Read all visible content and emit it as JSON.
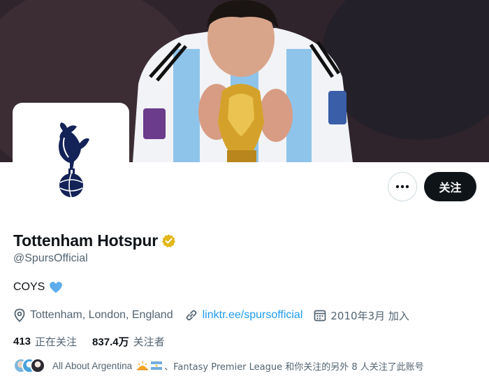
{
  "banner": {
    "description_icon": "world-cup-banner"
  },
  "profile": {
    "name": "Tottenham Hotspur",
    "handle": "@SpursOfficial",
    "bio": "COYS",
    "location": "Tottenham, London, England",
    "website": "linktr.ee/spursofficial",
    "joined": "2010年3月 加入"
  },
  "actions": {
    "more_label": "•••",
    "follow_label": "关注"
  },
  "stats": {
    "following_count": "413",
    "following_label": "正在关注",
    "followers_count": "837.4万",
    "followers_label": "关注者"
  },
  "followers_you_know": {
    "text_a": "All About Argentina",
    "text_b": "、Fantasy Premier League 和你关注的另外 8 人关注了此账号"
  },
  "colors": {
    "accent": "#1d9bf0",
    "text": "#0f1419",
    "muted": "#536471",
    "verified_gold": "#e2b719",
    "spurs_navy": "#132257"
  }
}
